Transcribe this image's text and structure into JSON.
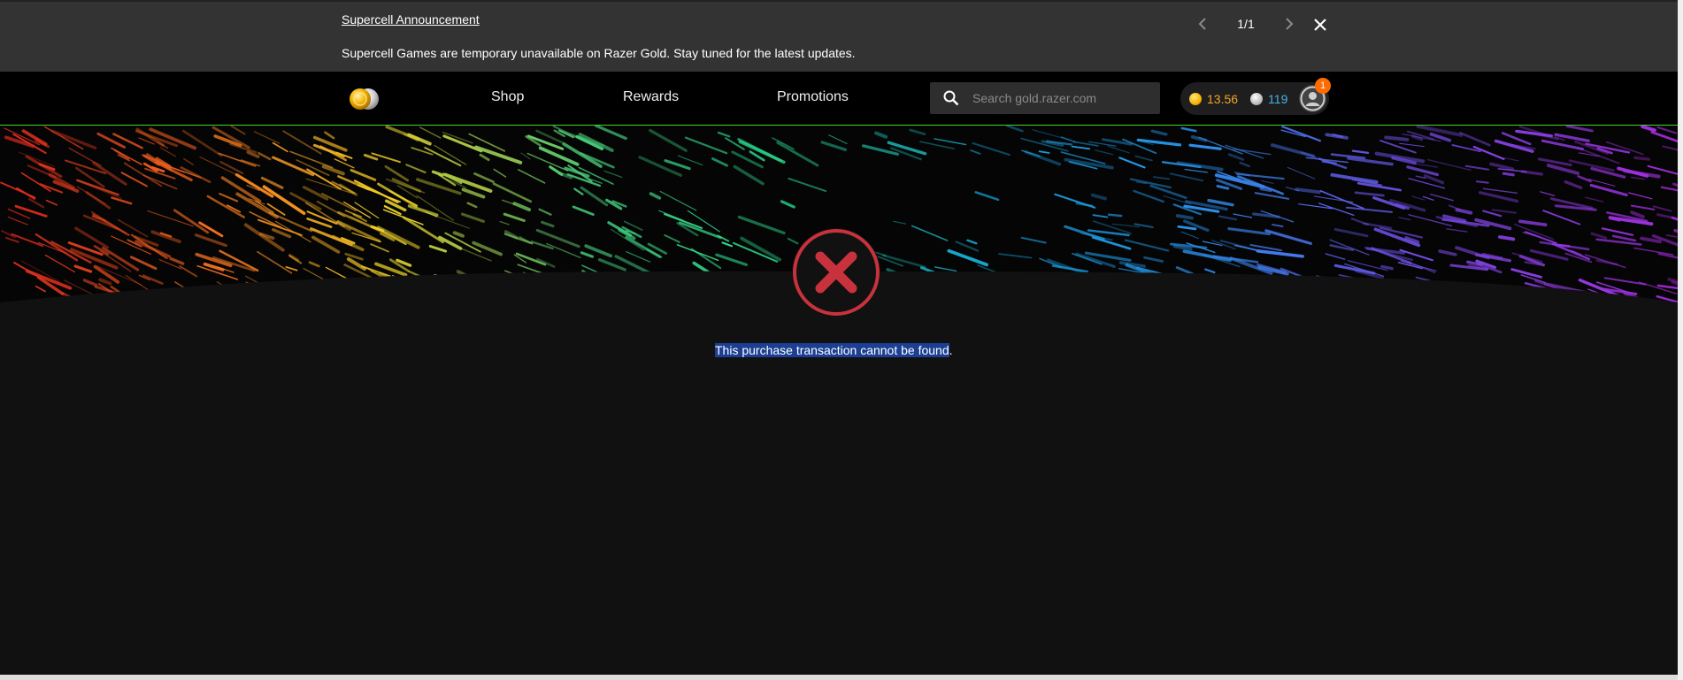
{
  "announcement": {
    "title": "Supercell Announcement",
    "message": "Supercell Games are temporary unavailable on Razer Gold. Stay tuned for the latest updates.",
    "pager": "1/1",
    "prev_icon": "chevron-left-icon",
    "next_icon": "chevron-right-icon",
    "close_icon": "close-icon"
  },
  "nav": {
    "logo_icon": "razer-gold-coins-logo",
    "links": [
      {
        "label": "Shop"
      },
      {
        "label": "Rewards"
      },
      {
        "label": "Promotions"
      }
    ],
    "search": {
      "placeholder": "Search gold.razer.com",
      "value": ""
    },
    "wallet": {
      "gold": "13.56",
      "silver": "119"
    },
    "notifications": "1"
  },
  "result": {
    "status_icon": "error-x-circle-icon",
    "message_selected": "This purchase transaction cannot be found",
    "message_tail": "."
  },
  "colors": {
    "background": "#111111",
    "announcement_bg": "#333333",
    "navbar_bg": "#000000",
    "accent_green": "#44d62c",
    "gold": "#f5a623",
    "silver": "#45b1e8",
    "error_red": "#c8323c",
    "badge_orange": "#ff6b00",
    "selection": "#1c3f94"
  }
}
